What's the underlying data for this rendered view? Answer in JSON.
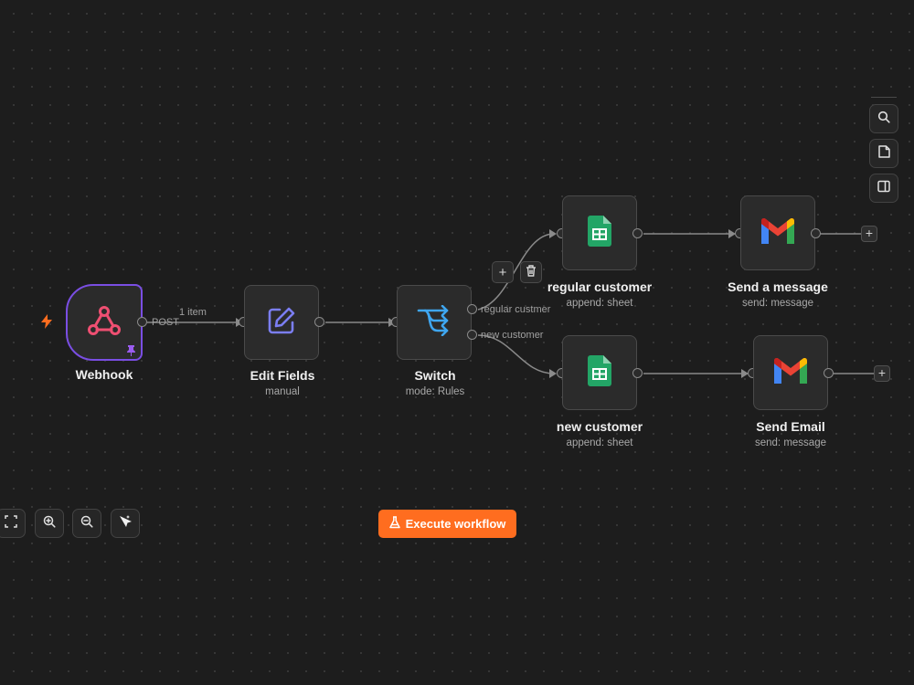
{
  "nodes": {
    "webhook": {
      "title": "Webhook",
      "subtitle": ""
    },
    "edit_fields": {
      "title": "Edit Fields",
      "subtitle": "manual"
    },
    "switch": {
      "title": "Switch",
      "subtitle": "mode: Rules"
    },
    "regular_customer": {
      "title": "regular customer",
      "subtitle": "append: sheet"
    },
    "send_message": {
      "title": "Send a message",
      "subtitle": "send: message"
    },
    "new_customer": {
      "title": "new customer",
      "subtitle": "append: sheet"
    },
    "send_email": {
      "title": "Send Email",
      "subtitle": "send: message"
    }
  },
  "edges": {
    "webhook_output": "POST",
    "item_count": "1 item",
    "switch_output_1": "regular custmer",
    "switch_output_2": "new customer"
  },
  "toolbar": {
    "execute_label": "Execute workflow",
    "add_symbol": "+",
    "delete_symbol": "🗑"
  },
  "icons": {
    "webhook": "webhook-icon",
    "edit_fields": "pencil-edit-icon",
    "switch": "switch-routing-icon",
    "sheets": "google-sheets-icon",
    "gmail": "gmail-icon",
    "trigger": "lightning-bolt-icon",
    "pin": "pin-icon",
    "side": [
      "search-icon",
      "sticky-note-icon",
      "panel-toggle-icon"
    ],
    "zoom": [
      "fit-view-icon",
      "zoom-in-icon",
      "zoom-out-icon",
      "tidy-up-icon"
    ],
    "execute": "flask-icon"
  },
  "colors": {
    "canvas": "#1d1d1d",
    "node": "#2b2b2b",
    "trigger_border": "#7a4ee3",
    "accent": "#ff6d1f",
    "webhook": "#ef4f72",
    "edit": "#7b7ef2",
    "switch": "#3fa6f0",
    "sheets": "#23a566"
  }
}
